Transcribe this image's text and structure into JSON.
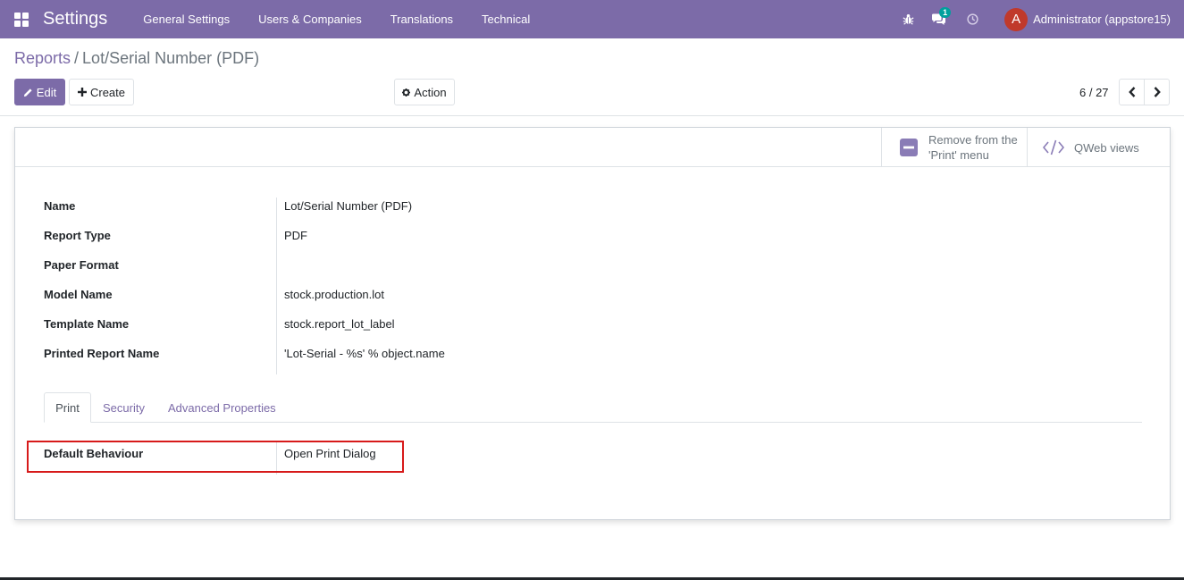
{
  "navbar": {
    "app_title": "Settings",
    "menu": [
      "General Settings",
      "Users & Companies",
      "Translations",
      "Technical"
    ],
    "chat_badge": "1",
    "user_initial": "A",
    "user_name": "Administrator (appstore15)",
    "bg_color": "#7c6ba8"
  },
  "breadcrumb": {
    "parent": "Reports",
    "separator": "/",
    "current": "Lot/Serial Number (PDF)"
  },
  "control_panel": {
    "edit_label": "Edit",
    "create_label": "Create",
    "action_label": "Action",
    "pager": "6 / 27"
  },
  "button_box": {
    "remove_label_line1": "Remove from the",
    "remove_label_line2": "'Print' menu",
    "qweb_label": "QWeb views"
  },
  "fields": [
    {
      "label": "Name",
      "value": "Lot/Serial Number (PDF)"
    },
    {
      "label": "Report Type",
      "value": "PDF"
    },
    {
      "label": "Paper Format",
      "value": ""
    },
    {
      "label": "Model Name",
      "value": "stock.production.lot"
    },
    {
      "label": "Template Name",
      "value": "stock.report_lot_label"
    },
    {
      "label": "Printed Report Name",
      "value": "'Lot-Serial - %s' % object.name"
    }
  ],
  "tabs": [
    "Print",
    "Security",
    "Advanced Properties"
  ],
  "print_tab": {
    "label": "Default Behaviour",
    "value": "Open Print Dialog"
  },
  "icons": [
    "apps-icon",
    "bug-icon",
    "chat-icon",
    "clock-icon",
    "pencil-icon",
    "plus-icon",
    "gear-icon",
    "chevron-left-icon",
    "chevron-right-icon",
    "minus-square-icon",
    "code-icon"
  ],
  "colors": {
    "accent": "#7c6ba8",
    "highlight": "#d71a1a",
    "badge": "#00a09d",
    "avatar": "#c0392b"
  }
}
